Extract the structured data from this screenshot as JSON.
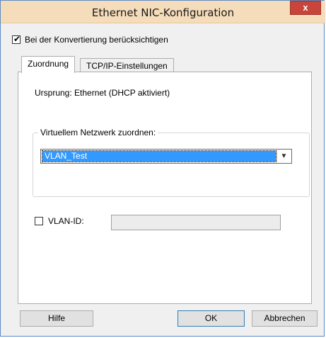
{
  "window": {
    "title": "Ethernet NIC-Konfiguration",
    "close_glyph": "x"
  },
  "consider_checkbox": {
    "label": "Bei der Konvertierung berücksichtigen",
    "checked": true
  },
  "tabs": [
    {
      "label": "Zuordnung",
      "active": true
    },
    {
      "label": "TCP/IP-Einstellungen",
      "active": false
    }
  ],
  "origin": {
    "text": "Ursprung: Ethernet (DHCP aktiviert)"
  },
  "network_group": {
    "label": "Virtuellem Netzwerk zuordnen:",
    "selected": "VLAN_Test"
  },
  "vlan": {
    "label": "VLAN-ID:",
    "checked": false,
    "value": ""
  },
  "buttons": {
    "help": "Hilfe",
    "ok": "OK",
    "cancel": "Abbrechen"
  }
}
